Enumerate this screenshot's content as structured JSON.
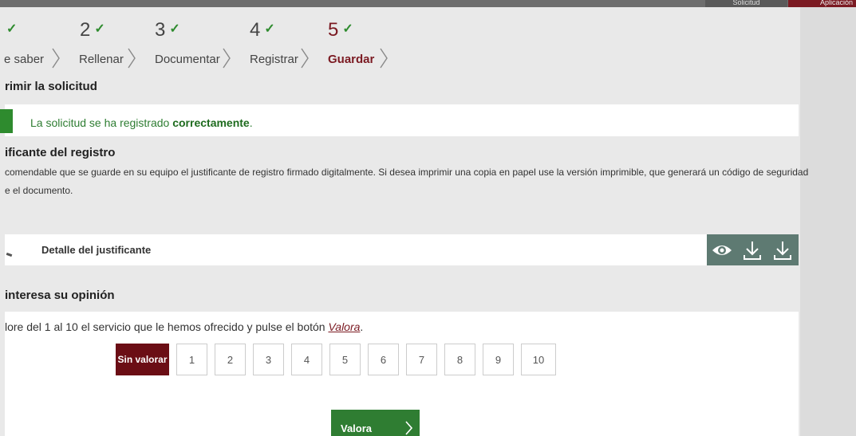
{
  "topbar": {
    "solicitud_label": "Solicitud",
    "aplicacion_label": "Aplicación"
  },
  "steps": [
    {
      "number": "",
      "label": "e saber",
      "done": true
    },
    {
      "number": "2",
      "label": "Rellenar",
      "done": true
    },
    {
      "number": "3",
      "label": "Documentar",
      "done": true
    },
    {
      "number": "4",
      "label": "Registrar",
      "done": true
    },
    {
      "number": "5",
      "label": "Guardar",
      "done": true,
      "active": true
    }
  ],
  "imprimir": {
    "title": "rimir la solicitud",
    "message_prefix": "La solicitud se ha registrado ",
    "message_strong": "correctamente",
    "message_suffix": "."
  },
  "justificante": {
    "title": "ificante del registro",
    "description_line1": "comendable que se guarde en su equipo el justificante de registro firmado digitalmente. Si desea imprimir una copia en papel use la versión imprimible, que generará un código de seguridad",
    "description_line2": "e el documento.",
    "detail_label": "Detalle del justificante",
    "actions": [
      "eye-icon",
      "download-icon",
      "download-icon"
    ]
  },
  "opinion": {
    "title": "interesa su opinión",
    "prompt_prefix": "lore del 1 al 10 el servicio que le hemos ofrecido y pulse el botón ",
    "prompt_link": "Valora",
    "prompt_suffix": ".",
    "options": [
      "Sin valorar",
      "1",
      "2",
      "3",
      "4",
      "5",
      "6",
      "7",
      "8",
      "9",
      "10"
    ],
    "selected": "Sin valorar",
    "submit_label": "Valora"
  },
  "colors": {
    "accent": "#7b1a22",
    "success": "#2e8b2e",
    "action_bar": "#5e7a72",
    "submit": "#2f7d32"
  }
}
